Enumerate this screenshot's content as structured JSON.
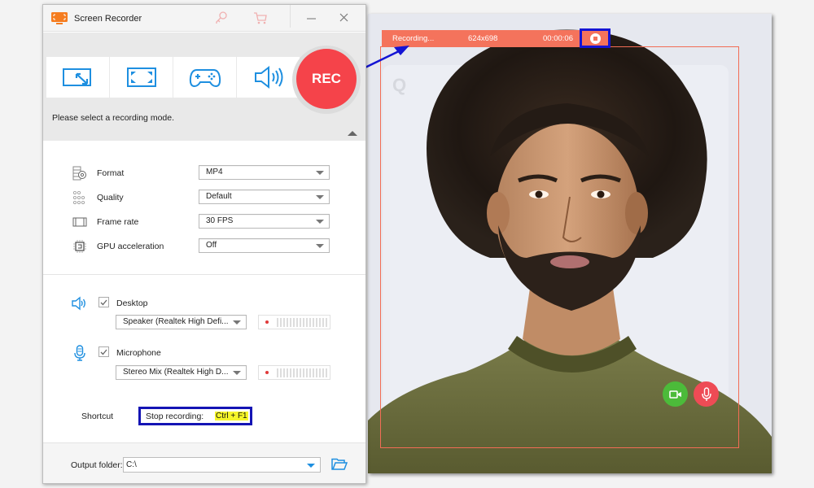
{
  "app": {
    "title": "Screen Recorder",
    "titlebar_icons": [
      "app-logo-icon",
      "key-icon",
      "cart-icon",
      "minimize-icon",
      "close-icon"
    ],
    "colors": {
      "accent_blue": "#1e8fe0",
      "rec_red": "#f5434a",
      "logo_orange": "#f57c1f"
    }
  },
  "modes": {
    "buttons": [
      {
        "name": "region",
        "icon": "region-select-icon"
      },
      {
        "name": "fullscreen",
        "icon": "fullscreen-icon"
      },
      {
        "name": "game",
        "icon": "gamepad-icon"
      },
      {
        "name": "audio",
        "icon": "speaker-icon"
      }
    ],
    "rec_label": "REC",
    "hint": "Please select a recording mode."
  },
  "settings": {
    "format": {
      "label": "Format",
      "value": "MP4"
    },
    "quality": {
      "label": "Quality",
      "value": "Default"
    },
    "frame_rate": {
      "label": "Frame rate",
      "value": "30 FPS"
    },
    "gpu": {
      "label": "GPU acceleration",
      "value": "Off"
    }
  },
  "audio": {
    "desktop": {
      "label": "Desktop",
      "checked": true,
      "device": "Speaker (Realtek High Defi..."
    },
    "microphone": {
      "label": "Microphone",
      "checked": true,
      "device": "Stereo Mix (Realtek High D..."
    }
  },
  "shortcut": {
    "label": "Shortcut",
    "action": "Stop recording:",
    "key": "Ctrl + F1"
  },
  "output": {
    "label": "Output folder:",
    "value": "C:\\"
  },
  "recording_bar": {
    "status": "Recording...",
    "resolution": "624x698",
    "timer": "00:00:06",
    "color": "#f4735c"
  },
  "preview": {
    "call_buttons": [
      "video-camera-icon",
      "microphone-icon"
    ],
    "logo": "Q"
  }
}
